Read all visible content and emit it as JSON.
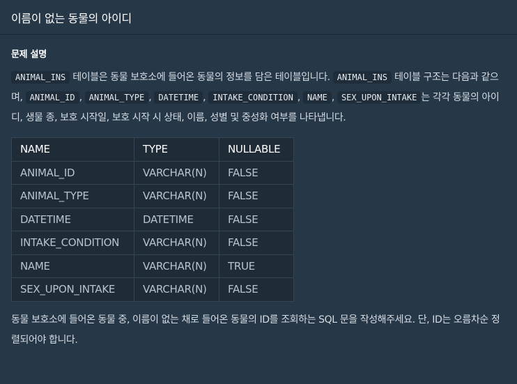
{
  "header": {
    "title": "이름이 없는 동물의 아이디"
  },
  "section": {
    "title": "문제 설명"
  },
  "desc": {
    "t1": "ANIMAL_INS",
    "t2": " 테이블은 동물 보호소에 들어온 동물의 정보를 담은 테이블입니다. ",
    "t3": "ANIMAL_INS",
    "t4": " 테이블 구조는 다음과 같으며, ",
    "c1": "ANIMAL_ID",
    "s1": ", ",
    "c2": "ANIMAL_TYPE",
    "s2": ", ",
    "c3": "DATETIME",
    "s3": ", ",
    "c4": "INTAKE_CONDITION",
    "s4": ", ",
    "c5": "NAME",
    "s5": ", ",
    "c6": "SEX_UPON_INTAKE",
    "t5": "는 각각 동물의 아이디, 생물 종, 보호 시작일, 보호 시작 시 상태, 이름, 성별 및 중성화 여부를 나타냅니다."
  },
  "table": {
    "headers": [
      "NAME",
      "TYPE",
      "NULLABLE"
    ],
    "rows": [
      [
        "ANIMAL_ID",
        "VARCHAR(N)",
        "FALSE"
      ],
      [
        "ANIMAL_TYPE",
        "VARCHAR(N)",
        "FALSE"
      ],
      [
        "DATETIME",
        "DATETIME",
        "FALSE"
      ],
      [
        "INTAKE_CONDITION",
        "VARCHAR(N)",
        "FALSE"
      ],
      [
        "NAME",
        "VARCHAR(N)",
        "TRUE"
      ],
      [
        "SEX_UPON_INTAKE",
        "VARCHAR(N)",
        "FALSE"
      ]
    ]
  },
  "footer": {
    "text": "동물 보호소에 들어온 동물 중, 이름이 없는 채로 들어온 동물의 ID를 조회하는 SQL 문을 작성해주세요. 단, ID는 오름차순 정렬되어야 합니다."
  }
}
